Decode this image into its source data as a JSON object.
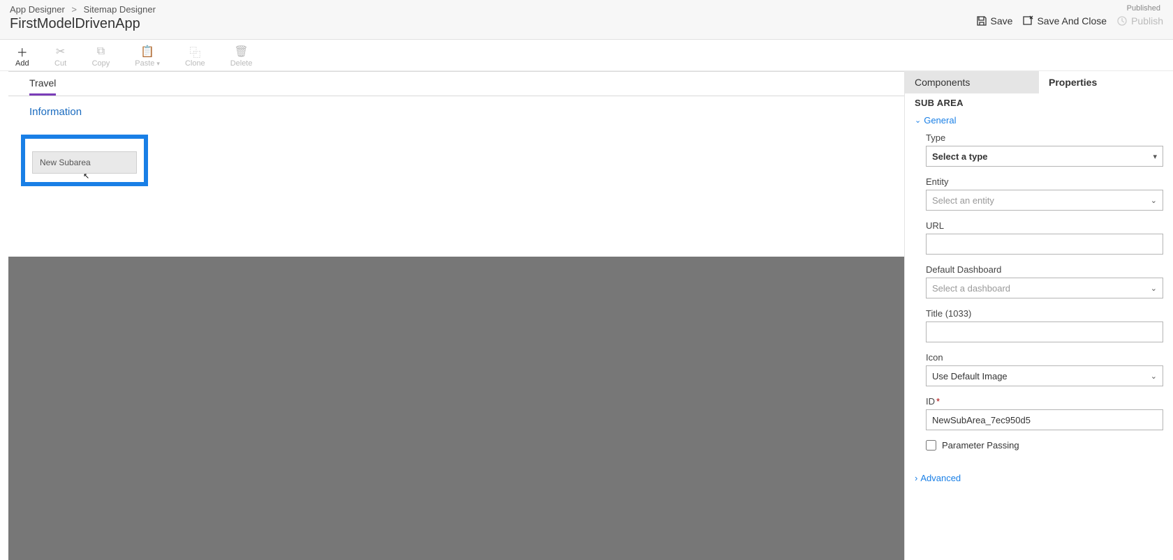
{
  "breadcrumb": {
    "root": "App Designer",
    "sep": ">",
    "leaf": "Sitemap Designer"
  },
  "app_title": "FirstModelDrivenApp",
  "status": "Published",
  "header_actions": {
    "save": "Save",
    "save_close": "Save And Close",
    "publish": "Publish"
  },
  "toolbar": {
    "add": "Add",
    "cut": "Cut",
    "copy": "Copy",
    "paste": "Paste",
    "clone": "Clone",
    "delete": "Delete"
  },
  "canvas": {
    "area": "Travel",
    "group": "Information",
    "subarea": "New Subarea"
  },
  "panel": {
    "tabs": {
      "components": "Components",
      "properties": "Properties"
    },
    "title": "SUB AREA",
    "sections": {
      "general": "General",
      "advanced": "Advanced"
    },
    "fields": {
      "type": {
        "label": "Type",
        "placeholder": "Select a type"
      },
      "entity": {
        "label": "Entity",
        "placeholder": "Select an entity"
      },
      "url": {
        "label": "URL"
      },
      "dashboard": {
        "label": "Default Dashboard",
        "placeholder": "Select a dashboard"
      },
      "title": {
        "label": "Title (1033)"
      },
      "icon": {
        "label": "Icon",
        "value": "Use Default Image"
      },
      "id": {
        "label": "ID",
        "req": "*",
        "value": "NewSubArea_7ec950d5"
      },
      "param": {
        "label": "Parameter Passing"
      }
    }
  }
}
